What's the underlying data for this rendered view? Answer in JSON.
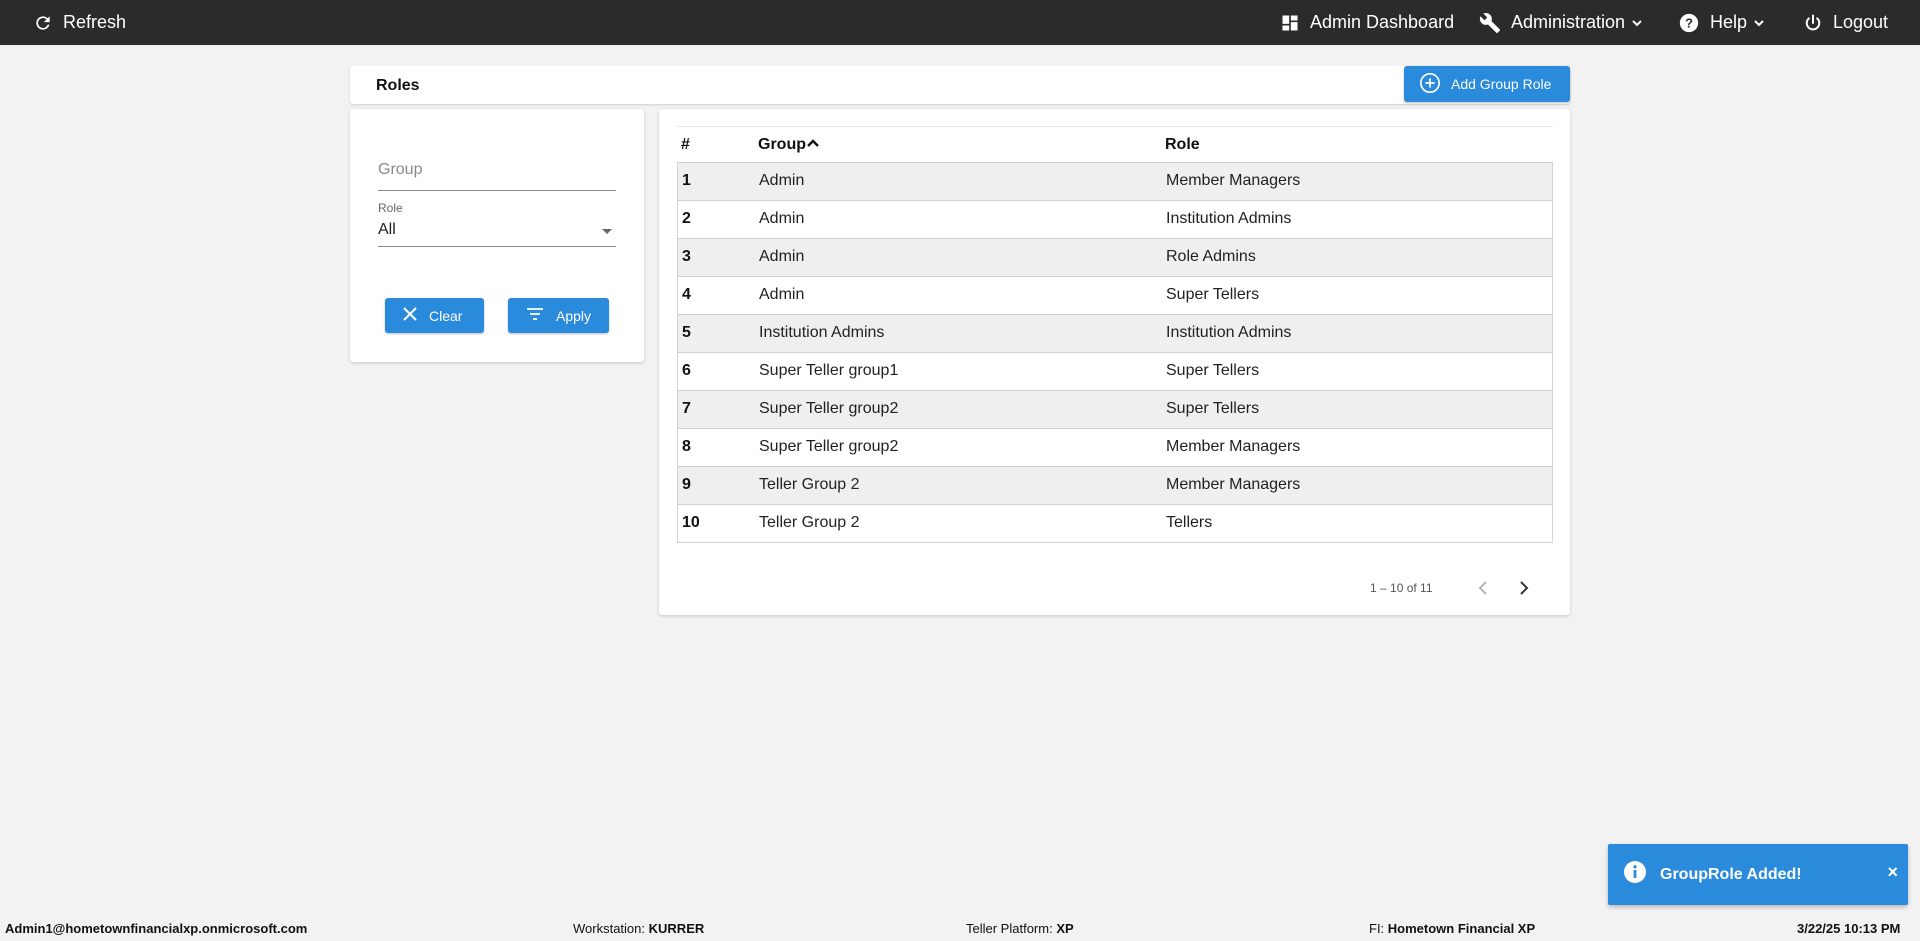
{
  "topbar": {
    "refresh_label": "Refresh",
    "dashboard_label": "Admin Dashboard",
    "administration_label": "Administration",
    "help_label": "Help",
    "logout_label": "Logout"
  },
  "page": {
    "title": "Roles",
    "add_button_label": "Add Group Role"
  },
  "filters": {
    "group_placeholder": "Group",
    "group_value": "",
    "role_label": "Role",
    "role_value": "All",
    "clear_label": "Clear",
    "apply_label": "Apply"
  },
  "table": {
    "columns": [
      "#",
      "Group",
      "Role"
    ],
    "sorted_column": "Group",
    "sort_direction": "ascending",
    "rows": [
      {
        "num": "1",
        "group": "Admin",
        "role": "Member Managers"
      },
      {
        "num": "2",
        "group": "Admin",
        "role": "Institution Admins"
      },
      {
        "num": "3",
        "group": "Admin",
        "role": "Role Admins"
      },
      {
        "num": "4",
        "group": "Admin",
        "role": "Super Tellers"
      },
      {
        "num": "5",
        "group": "Institution Admins",
        "role": "Institution Admins"
      },
      {
        "num": "6",
        "group": "Super Teller group1",
        "role": "Super Tellers"
      },
      {
        "num": "7",
        "group": "Super Teller group2",
        "role": "Super Tellers"
      },
      {
        "num": "8",
        "group": "Super Teller group2",
        "role": "Member Managers"
      },
      {
        "num": "9",
        "group": "Teller Group 2",
        "role": "Member Managers"
      },
      {
        "num": "10",
        "group": "Teller Group 2",
        "role": "Tellers"
      }
    ],
    "pagination_text": "1 – 10 of 11"
  },
  "toast": {
    "message": "GroupRole Added!",
    "close": "×"
  },
  "status": {
    "user": "Admin1@hometownfinancialxp.onmicrosoft.com",
    "workstation_label": "Workstation:",
    "workstation": "KURRER",
    "platform_label": "Teller Platform:",
    "platform": "XP",
    "fi_label": "FI:",
    "fi": "Hometown Financial XP",
    "datetime": "3/22/25 10:13 PM"
  },
  "colors": {
    "topbar_bg": "#2b2b2b",
    "accent": "#2a8bdc",
    "page_bg": "#f2f2f2",
    "row_stripe": "#efefef"
  },
  "icons": {
    "refresh": "refresh-icon",
    "dashboard": "dashboard-icon",
    "administration": "wrench-icon",
    "help": "help-icon",
    "logout": "power-icon",
    "add": "add-circle-icon",
    "clear": "close-icon",
    "apply": "filter-icon",
    "sort": "sort-up-icon",
    "toast": "info-icon"
  }
}
